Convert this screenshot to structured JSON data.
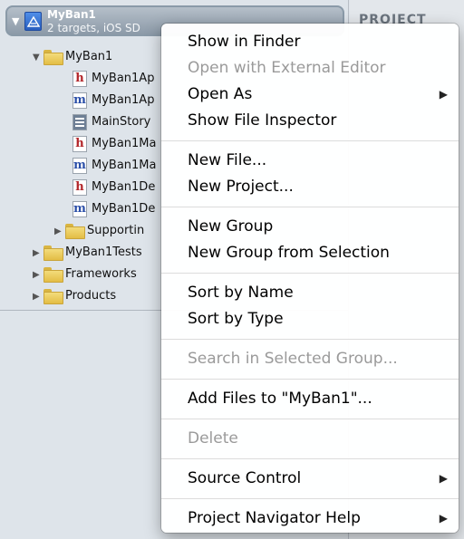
{
  "project": {
    "name": "MyBan1",
    "subtitle": "2 targets, iOS SD"
  },
  "tree": [
    {
      "label": "MyBan1",
      "kind": "folder",
      "expanded": true
    },
    {
      "label": "MyBan1Ap",
      "kind": "h"
    },
    {
      "label": "MyBan1Ap",
      "kind": "m"
    },
    {
      "label": "MainStory",
      "kind": "storyboard"
    },
    {
      "label": "MyBan1Ma",
      "kind": "h"
    },
    {
      "label": "MyBan1Ma",
      "kind": "m"
    },
    {
      "label": "MyBan1De",
      "kind": "h"
    },
    {
      "label": "MyBan1De",
      "kind": "m"
    },
    {
      "label": "Supportin",
      "kind": "folder"
    },
    {
      "label": "MyBan1Tests",
      "kind": "folder"
    },
    {
      "label": "Frameworks",
      "kind": "folder"
    },
    {
      "label": "Products",
      "kind": "folder"
    }
  ],
  "right_pane": {
    "header": "PROJECT"
  },
  "menu": {
    "show_in_finder": "Show in Finder",
    "open_external": "Open with External Editor",
    "open_as": "Open As",
    "show_file_inspector": "Show File Inspector",
    "new_file": "New File...",
    "new_project": "New Project...",
    "new_group": "New Group",
    "new_group_from_selection": "New Group from Selection",
    "sort_by_name": "Sort by Name",
    "sort_by_type": "Sort by Type",
    "search_in_group": "Search in Selected Group...",
    "add_files": "Add Files to \"MyBan1\"...",
    "delete": "Delete",
    "source_control": "Source Control",
    "navigator_help": "Project Navigator Help",
    "submenu_arrow": "▶"
  }
}
